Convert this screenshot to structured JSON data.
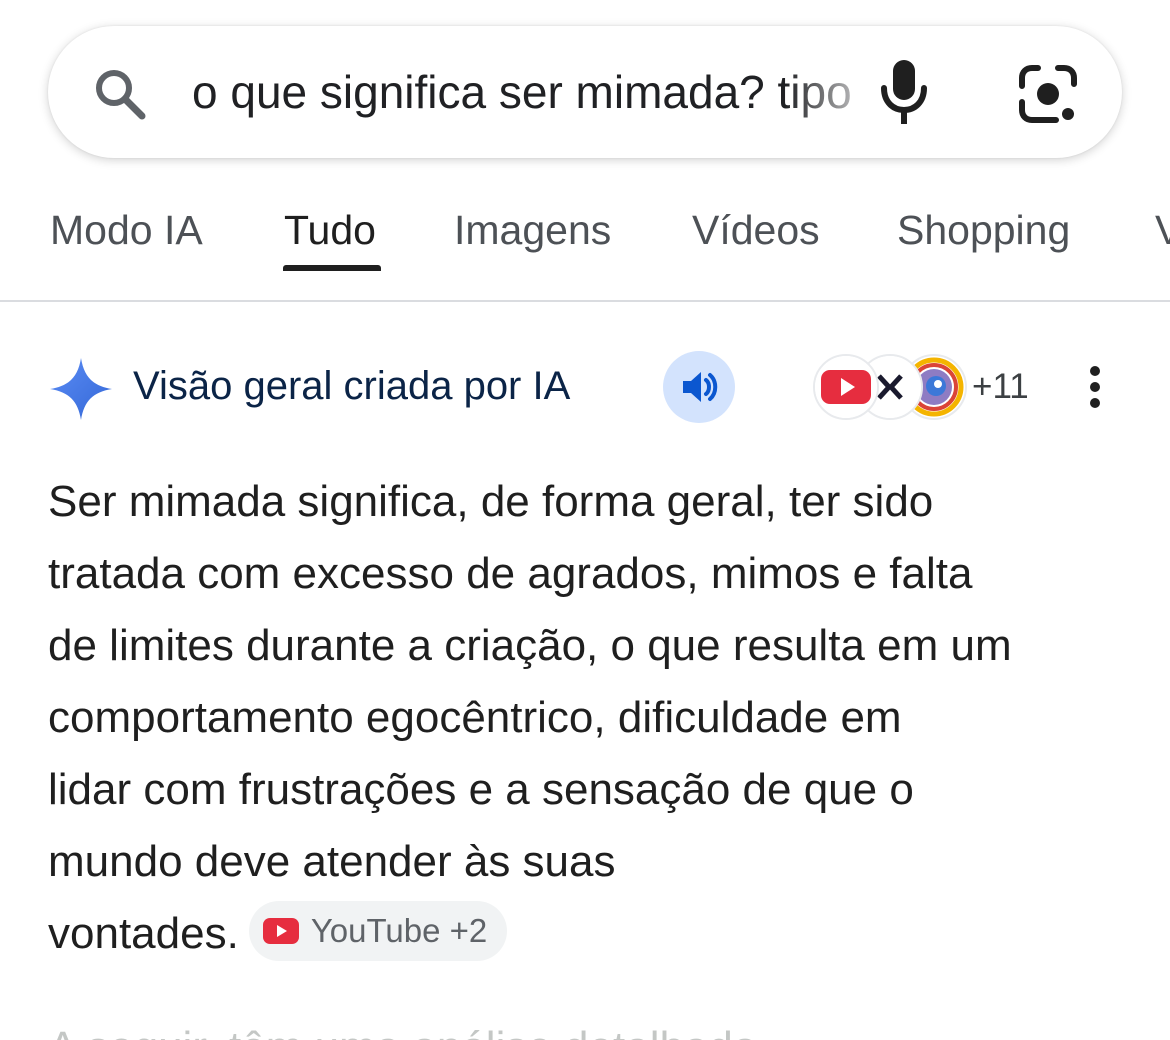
{
  "search": {
    "query": "o que significa ser mimada? tipo",
    "icons": {
      "left": "search-icon",
      "voice": "mic-icon",
      "lens": "google-lens-icon"
    }
  },
  "tabs": [
    {
      "label": "Modo IA",
      "active": false
    },
    {
      "label": "Tudo",
      "active": true
    },
    {
      "label": "Imagens",
      "active": false
    },
    {
      "label": "Vídeos",
      "active": false
    },
    {
      "label": "Shopping",
      "active": false
    },
    {
      "label": "V",
      "active": false
    }
  ],
  "ai_overview": {
    "title": "Visão geral criada por IA",
    "sources_more": "+11",
    "source_icons": [
      "youtube-icon",
      "brand-source-icon",
      "rainbow-source-icon"
    ],
    "answer_lines": [
      "Ser mimada significa, de forma geral, ter sido",
      "tratada com excesso de agrados, mimos e falta",
      "de limites durante a criação, o que resulta em um",
      "comportamento egocêntrico, dificuldade em",
      "lidar com frustrações e a sensação de que o",
      "mundo deve atender às suas",
      "vontades."
    ],
    "citation_chip": "YouTube +2",
    "next_line": "A seguir, têm uma análise detalhada"
  },
  "colors": {
    "accent_blue": "#4285f4",
    "ai_title": "#0b2447",
    "speaker_bg": "#d3e3fd",
    "youtube_red": "#e62d3f"
  }
}
